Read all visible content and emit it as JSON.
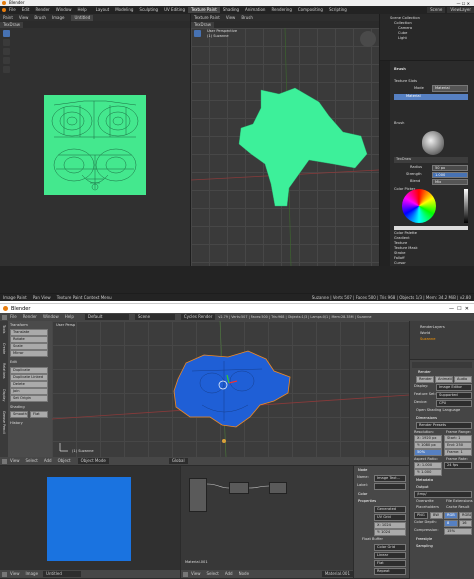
{
  "top": {
    "title": "Blender",
    "menu": [
      "File",
      "Edit",
      "Render",
      "Window",
      "Help"
    ],
    "workspaces": [
      "Layout",
      "Modeling",
      "Sculpting",
      "UV Editing",
      "Texture Paint",
      "Shading",
      "Animation",
      "Rendering",
      "Compositing",
      "Scripting"
    ],
    "active_workspace": "Texture Paint",
    "scene": "Scene",
    "view_layer": "ViewLayer",
    "image_editor": {
      "mode": "Paint",
      "menus": [
        "View",
        "Brush",
        "Image"
      ],
      "image": "Untitled",
      "brush": "TexDraw"
    },
    "viewport": {
      "mode": "Texture Paint",
      "menus": [
        "View",
        "Brush"
      ],
      "brush": "TexDraw",
      "label1": "User Perspective",
      "label2": "(1) Suzanne"
    },
    "outliner": {
      "items": [
        "Scene Collection",
        "Collection",
        "Camera",
        "Cube",
        "Light"
      ]
    },
    "props": {
      "brush_header": "Brush",
      "sections": [
        "Texture Slots",
        "Brush",
        "Color Picker"
      ],
      "mode_label": "Mode",
      "mode_value": "Material",
      "slot": "Material",
      "brush_name": "TexDraw",
      "radius_label": "Radius",
      "radius_value": "50 px",
      "strength_label": "Strength",
      "strength_value": "1.000",
      "blend_label": "Blend",
      "blend_value": "Mix",
      "collapsed": [
        "Color Palette",
        "Gradient",
        "Texture",
        "Texture Mask",
        "Stroke",
        "Falloff",
        "Cursor",
        "Symmetry",
        "Options",
        "Workspace"
      ]
    },
    "status": {
      "left": [
        "Image Paint",
        "Pan View",
        "Texture Paint Context Menu"
      ],
      "right": "Suzanne | Verts 507 | Faces 500 | Tris 968 | Objects 1/3 | Mem: 34.2 MiB | v2.80"
    },
    "colors": {
      "uv": "#44e88e",
      "mesh": "#3df09a"
    }
  },
  "bottom": {
    "title": "Blender",
    "menu": [
      "File",
      "Render",
      "Window",
      "Help"
    ],
    "layout": "Default",
    "scene": "Scene",
    "engine": "Cycles Render",
    "stats": "v2.79 | Verts:507 | Faces:500 | Tris:968 | Objects:1/3 | Lamps:0/1 | Mem:28.35M | Suzanne",
    "tool_tabs": [
      "Tools",
      "Create",
      "Relations",
      "Display",
      "Grease Pencil"
    ],
    "transform": {
      "header": "Transform",
      "buttons": [
        "Translate",
        "Rotate",
        "Scale",
        "Mirror"
      ]
    },
    "edit": {
      "header": "Edit",
      "buttons": [
        "Duplicate",
        "Duplicate Linked",
        "Delete",
        "Join",
        "Set Origin"
      ]
    },
    "history": {
      "header": "History",
      "buttons": [
        "Shading",
        "Smooth",
        "Flat"
      ]
    },
    "viewport": {
      "label": "User Persp",
      "object": "(1) Suzanne",
      "menus": [
        "View",
        "Select",
        "Add",
        "Object"
      ],
      "mode": "Object Mode",
      "shading": "Global"
    },
    "outliner": {
      "items": [
        "RenderLayers",
        "World",
        "Suzanne"
      ]
    },
    "props": {
      "render_header": "Render",
      "render_buttons": [
        "Render",
        "Animation",
        "Audio"
      ],
      "display_label": "Display:",
      "display_value": "Image Editor",
      "feature_label": "Feature Set:",
      "feature_value": "Supported",
      "device_label": "Device:",
      "device_value": "CPU",
      "osl": "Open Shading Language",
      "dimensions": "Dimensions",
      "presets": "Render Presets",
      "res_label": "Resolution:",
      "res_x": "X: 1920 px",
      "res_y": "Y: 1080 px",
      "res_pct": "50%",
      "frame_label": "Frame Range:",
      "frame_start": "Start: 1",
      "frame_end": "End: 250",
      "frame_step": "Frame: 1",
      "aspect_label": "Aspect Ratio:",
      "aspect_x": "X: 1.000",
      "aspect_y": "Y: 1.000",
      "rate_label": "Frame Rate:",
      "rate_value": "24 fps",
      "metadata": "Metadata",
      "output": "Output",
      "output_path": "/tmp/",
      "overwrite": "Overwrite",
      "file_ext": "File Extensions",
      "placeholders": "Placeholders",
      "cache": "Cache Result",
      "formats": [
        "PNG",
        "BW",
        "RGB",
        "RGBA"
      ],
      "color_depth": "Color Depth:",
      "depth": [
        "8",
        "16"
      ],
      "compression": "Compression:",
      "compression_value": "15%",
      "sections": [
        "Freestyle",
        "Sampling"
      ]
    },
    "image_editor": {
      "menus": [
        "View",
        "Image"
      ],
      "image": "Untitled",
      "color": "#1a73e0"
    },
    "node_editor": {
      "menus": [
        "View",
        "Select",
        "Add",
        "Node"
      ],
      "material": "Material.001"
    },
    "node_props": {
      "node_header": "Node",
      "name_label": "Name:",
      "name_value": "Image Text...",
      "label_label": "Label:",
      "color": "Color",
      "properties": "Properties",
      "source": "Generated",
      "uv_grid": "UV Grid",
      "size_x": "X: 1024",
      "size_y": "Y: 1024",
      "float_buffer": "Float Buffer",
      "interp": "Linear",
      "projection": "Flat",
      "extension": "Repeat",
      "color_grid": "Color Grid"
    },
    "status_menus": [
      "View",
      "Image"
    ],
    "colors": {
      "mesh": "#1f5fd6",
      "image": "#1a73e0"
    }
  }
}
